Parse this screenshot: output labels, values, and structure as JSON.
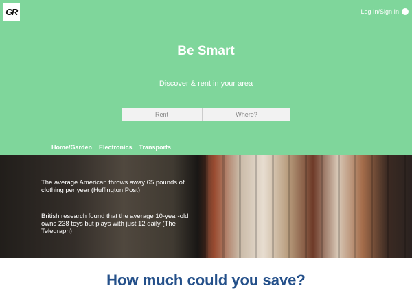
{
  "header": {
    "logo_text": "GR",
    "login_label": "Log In/Sign In"
  },
  "hero": {
    "title": "Be Smart",
    "subtitle": "Discover & rent in your area",
    "search": {
      "rent_placeholder": "Rent",
      "where_placeholder": "Where?"
    },
    "categories": [
      "Home/Garden",
      "Electronics",
      "Transports"
    ]
  },
  "facts": [
    "The average American throws away 65 pounds of clothing per year (Huffington Post)",
    "British research found that the average 10-year-old owns 238 toys but plays with just 12 daily (The Telegraph)"
  ],
  "savings": {
    "heading": "How much could you save?"
  },
  "colors": {
    "hero_bg": "#7fd69b",
    "heading_blue": "#24508a"
  }
}
